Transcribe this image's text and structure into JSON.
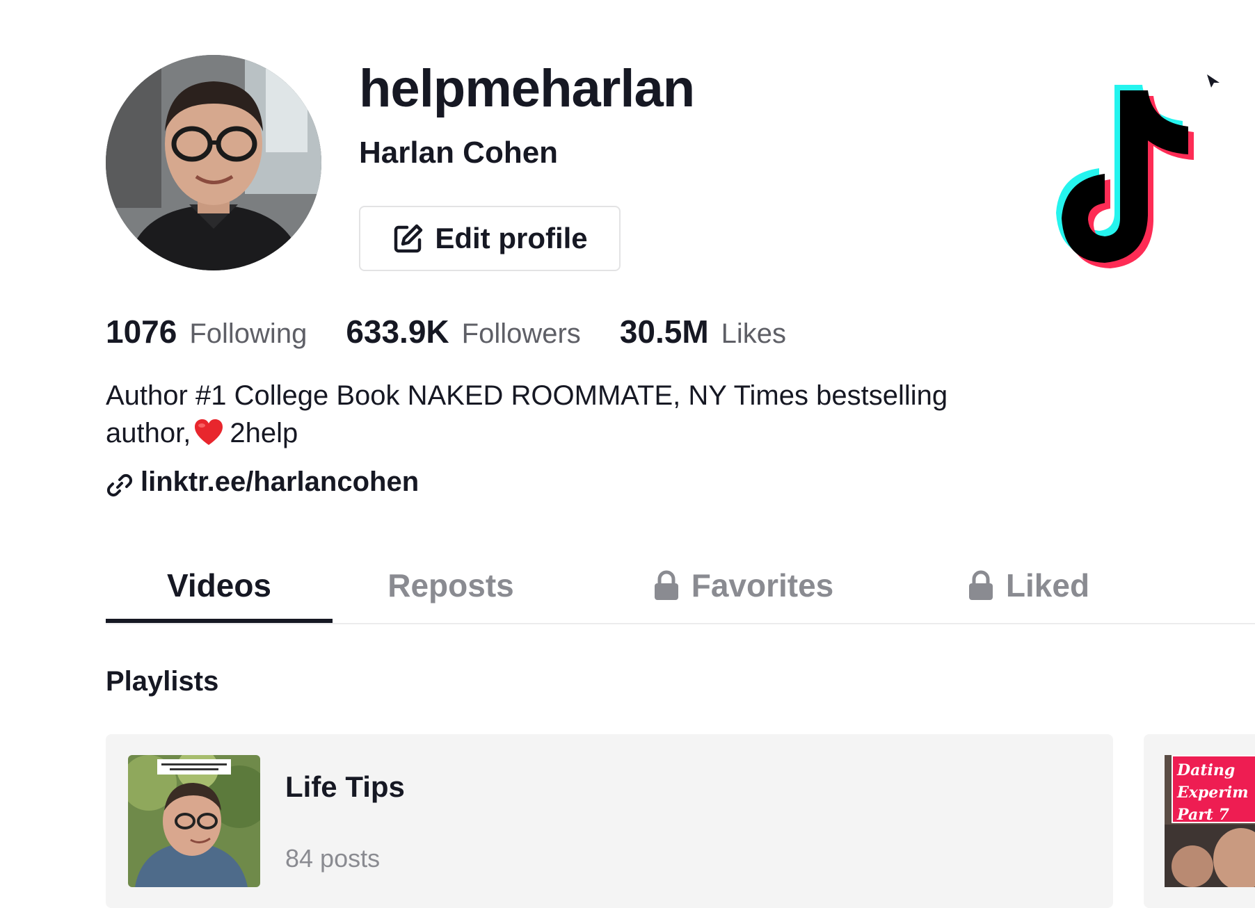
{
  "profile": {
    "username": "helpmeharlan",
    "display_name": "Harlan Cohen",
    "edit_profile_label": "Edit profile"
  },
  "stats": [
    {
      "value": "1076",
      "label": "Following"
    },
    {
      "value": "633.9K",
      "label": "Followers"
    },
    {
      "value": "30.5M",
      "label": "Likes"
    }
  ],
  "bio": {
    "text_before_emoji": "Author #1 College Book NAKED ROOMMATE, NY Times bestselling author,",
    "emoji": "red-heart",
    "text_after_emoji": "2help"
  },
  "link": {
    "text": "linktr.ee/harlancohen"
  },
  "tabs": [
    {
      "label": "Videos",
      "active": true,
      "locked": false
    },
    {
      "label": "Reposts",
      "active": false,
      "locked": false
    },
    {
      "label": "Favorites",
      "active": false,
      "locked": true
    },
    {
      "label": "Liked",
      "active": false,
      "locked": true
    }
  ],
  "playlists": {
    "section_title": "Playlists",
    "items": [
      {
        "title": "Life Tips",
        "count": "84 posts"
      },
      {
        "overlay_lines": [
          "Dating",
          "Experim",
          "Part 7"
        ]
      }
    ]
  },
  "colors": {
    "text_primary": "#161823",
    "text_secondary": "#8a8b91",
    "tiktok_cyan": "#25f4ee",
    "tiktok_red": "#fe2c55",
    "card_bg": "#f4f4f4"
  },
  "icons": {
    "edit": "edit-square-icon",
    "link": "link-icon",
    "lock": "lock-icon",
    "logo": "tiktok-logo-icon"
  }
}
